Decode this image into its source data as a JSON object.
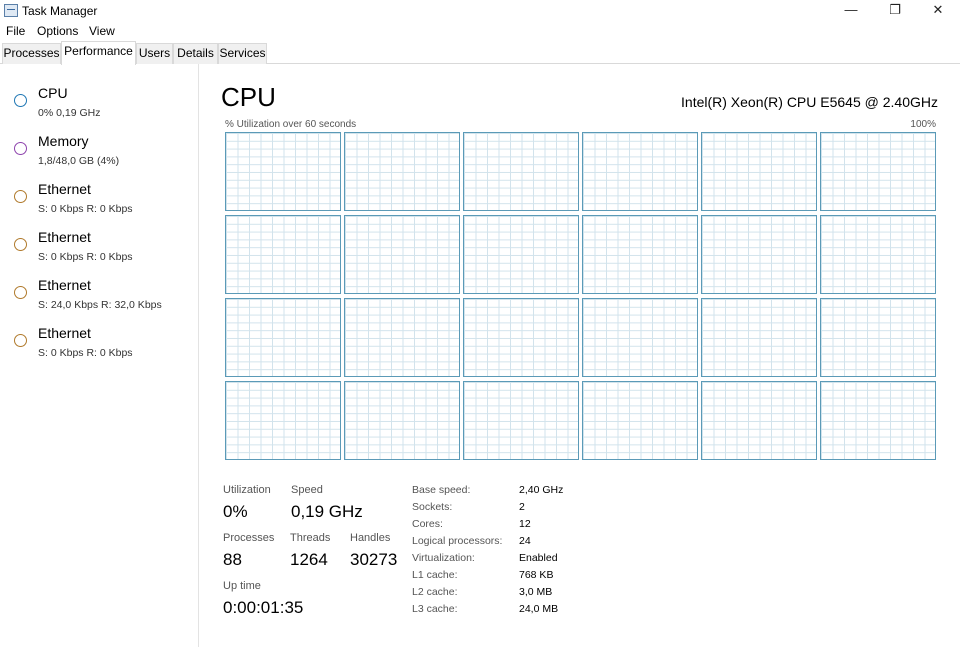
{
  "window": {
    "title": "Task Manager",
    "minimize_glyph": "—",
    "maximize_glyph": "❐",
    "close_glyph": "✕"
  },
  "menu": [
    "File",
    "Options",
    "View"
  ],
  "tabs": [
    {
      "label": "Processes",
      "active": false
    },
    {
      "label": "Performance",
      "active": true
    },
    {
      "label": "Users",
      "active": false
    },
    {
      "label": "Details",
      "active": false
    },
    {
      "label": "Services",
      "active": false
    }
  ],
  "sidebar": {
    "items": [
      {
        "name": "CPU",
        "sub": "0%  0,19 GHz",
        "color": "#1f77b4",
        "selected": true
      },
      {
        "name": "Memory",
        "sub": "1,8/48,0 GB (4%)",
        "color": "#8e44ad",
        "selected": false
      },
      {
        "name": "Ethernet",
        "sub": "S: 0 Kbps  R: 0 Kbps",
        "color": "#b07a2c",
        "selected": false
      },
      {
        "name": "Ethernet",
        "sub": "S: 0 Kbps  R: 0 Kbps",
        "color": "#b07a2c",
        "selected": false
      },
      {
        "name": "Ethernet",
        "sub": "S: 24,0 Kbps  R: 32,0 Kbps",
        "color": "#b07a2c",
        "selected": false
      },
      {
        "name": "Ethernet",
        "sub": "S: 0 Kbps  R: 0 Kbps",
        "color": "#b07a2c",
        "selected": false
      }
    ]
  },
  "main": {
    "title": "CPU",
    "cpu_model": "Intel(R) Xeon(R) CPU E5645 @ 2.40GHz",
    "graph_label": "% Utilization over 60 seconds",
    "graph_max": "100%",
    "graph_count": 24,
    "graph_border_color": "#5b9ab7"
  },
  "stats": {
    "utilization_label": "Utilization",
    "utilization_value": "0%",
    "speed_label": "Speed",
    "speed_value": "0,19 GHz",
    "processes_label": "Processes",
    "processes_value": "88",
    "threads_label": "Threads",
    "threads_value": "1264",
    "handles_label": "Handles",
    "handles_value": "30273",
    "uptime_label": "Up time",
    "uptime_value": "0:00:01:35"
  },
  "specs": [
    {
      "label": "Base speed:",
      "value": "2,40 GHz"
    },
    {
      "label": "Sockets:",
      "value": "2"
    },
    {
      "label": "Cores:",
      "value": "12"
    },
    {
      "label": "Logical processors:",
      "value": "24"
    },
    {
      "label": "Virtualization:",
      "value": "Enabled"
    },
    {
      "label": "L1 cache:",
      "value": "768 KB"
    },
    {
      "label": "L2 cache:",
      "value": "3,0 MB"
    },
    {
      "label": "L3 cache:",
      "value": "24,0 MB"
    }
  ]
}
